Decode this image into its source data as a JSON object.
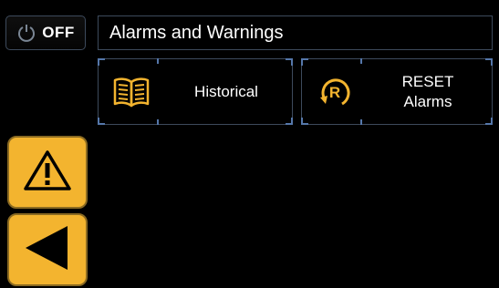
{
  "power": {
    "label": "OFF",
    "icon": "power-icon"
  },
  "header": {
    "title": "Alarms and Warnings"
  },
  "buttons": {
    "historical": {
      "label": "Historical",
      "icon": "book-icon"
    },
    "reset": {
      "line1": "RESET",
      "line2": "Alarms",
      "icon": "reset-r-icon"
    }
  },
  "side": {
    "warning_icon": "warning-icon",
    "back_icon": "back-arrow-icon"
  },
  "colors": {
    "accent": "#f3b42f",
    "border": "#3d4a5c",
    "background": "#000000"
  }
}
